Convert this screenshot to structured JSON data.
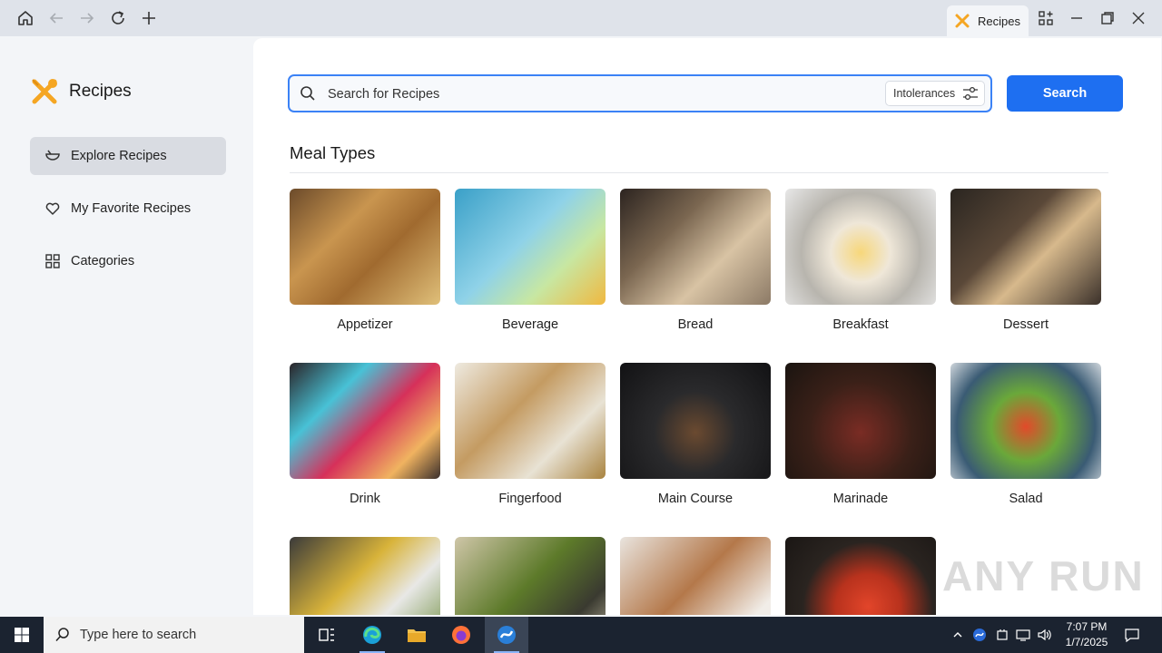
{
  "browser": {
    "tab_title": "Recipes"
  },
  "sidebar": {
    "app_title": "Recipes",
    "items": [
      {
        "label": "Explore Recipes",
        "icon": "bowl-icon",
        "active": true
      },
      {
        "label": "My Favorite Recipes",
        "icon": "heart-icon",
        "active": false
      },
      {
        "label": "Categories",
        "icon": "grid-icon",
        "active": false
      }
    ]
  },
  "search": {
    "placeholder": "Search for Recipes",
    "value": "",
    "intolerances_label": "Intolerances",
    "button_label": "Search"
  },
  "main": {
    "section_title": "Meal Types",
    "meal_types": [
      {
        "label": "Appetizer"
      },
      {
        "label": "Beverage"
      },
      {
        "label": "Bread"
      },
      {
        "label": "Breakfast"
      },
      {
        "label": "Dessert"
      },
      {
        "label": "Drink"
      },
      {
        "label": "Fingerfood"
      },
      {
        "label": "Main Course"
      },
      {
        "label": "Marinade"
      },
      {
        "label": "Salad"
      }
    ]
  },
  "taskbar": {
    "search_placeholder": "Type here to search",
    "time": "7:07 PM",
    "date": "1/7/2025"
  },
  "watermark": "ANY RUN",
  "colors": {
    "accent": "#1e6ff1",
    "search_border": "#3b82f6",
    "brand_orange": "#f5a623"
  }
}
